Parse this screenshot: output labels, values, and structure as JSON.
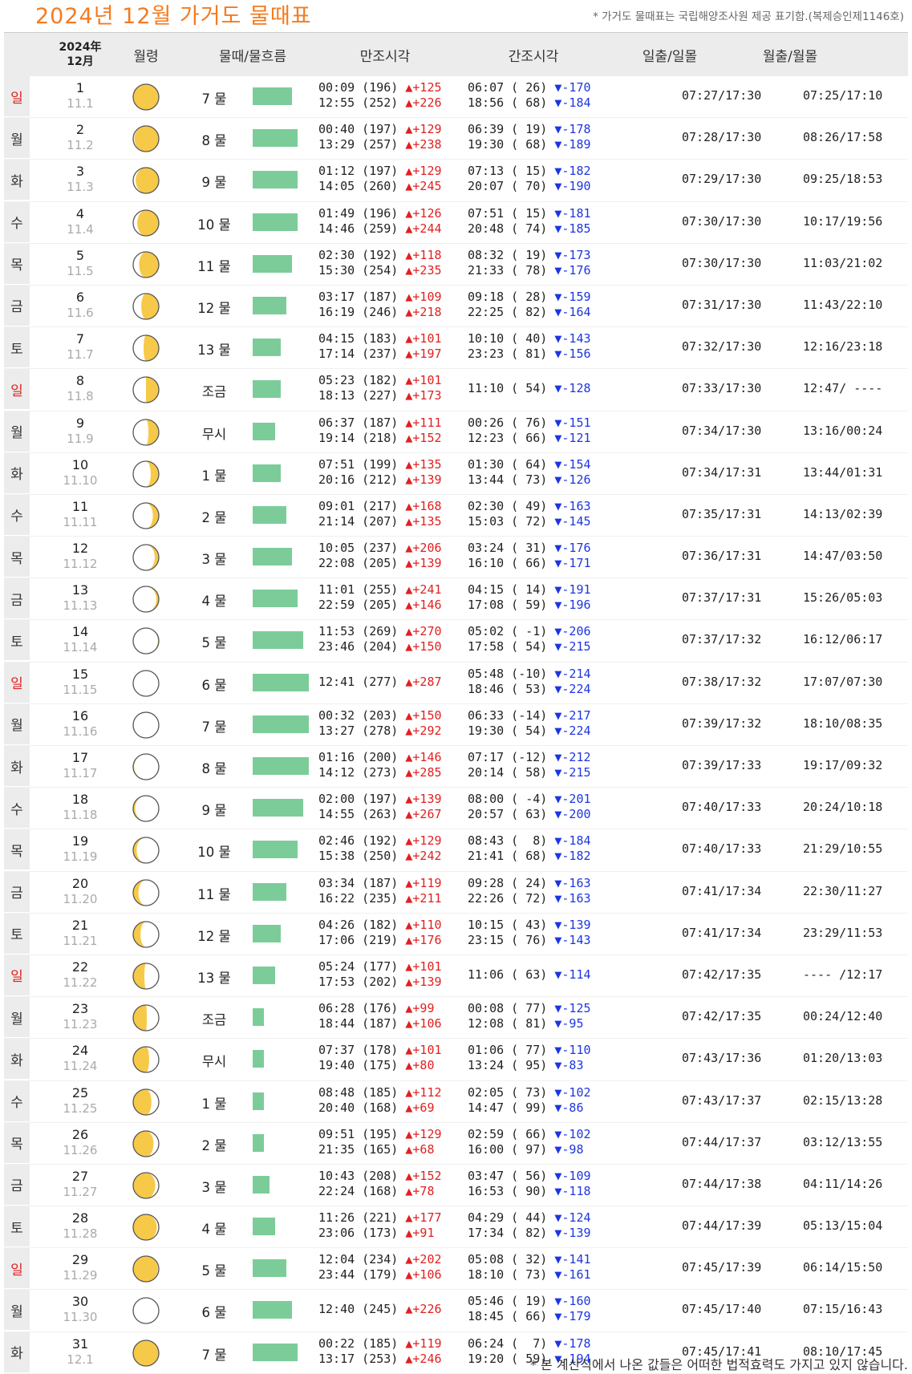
{
  "title": "2024년 12월 가거도 물때표",
  "notice": "* 가거도 물때표는 국립해양조사원 제공 표기함.(복제승인제1146호)",
  "footer": "* 본 계산식에서 나온 값들은 어떠한 법적효력도 가지고 있지 않습니다.",
  "headers": {
    "year": "2024年",
    "month": "12月",
    "moon_age": "월령",
    "tide": "물때/물흐름",
    "high": "만조시각",
    "low": "간조시각",
    "sun": "일출/일몰",
    "moon": "월출/월몰"
  },
  "colors": {
    "title": "#f47b20",
    "sunday": "#e02020",
    "rise": "#e02020",
    "fall": "#1d35e0",
    "flow_bar": "#7ccc9a",
    "moon_fill": "#f7c948"
  },
  "rows": [
    {
      "dow": "일",
      "sun": true,
      "day": "1",
      "lunar": "11.1",
      "mul": "7 물",
      "flow": 0.7,
      "phase": 0.04,
      "high": [
        "00:09 (196)",
        "12:55 (252)"
      ],
      "hc": [
        "+125",
        "+226"
      ],
      "low": [
        "06:07 ( 26)",
        "18:56 ( 68)"
      ],
      "lc": [
        "-170",
        "-184"
      ],
      "sr": "07:27/17:30",
      "mr": "07:25/17:10"
    },
    {
      "dow": "월",
      "sun": false,
      "day": "2",
      "lunar": "11.2",
      "mul": "8 물",
      "flow": 0.8,
      "phase": 0.07,
      "high": [
        "00:40 (197)",
        "13:29 (257)"
      ],
      "hc": [
        "+129",
        "+238"
      ],
      "low": [
        "06:39 ( 19)",
        "19:30 ( 68)"
      ],
      "lc": [
        "-178",
        "-189"
      ],
      "sr": "07:28/17:30",
      "mr": "08:26/17:58"
    },
    {
      "dow": "화",
      "sun": false,
      "day": "3",
      "lunar": "11.3",
      "mul": "9 물",
      "flow": 0.8,
      "phase": 0.1,
      "high": [
        "01:12 (197)",
        "14:05 (260)"
      ],
      "hc": [
        "+129",
        "+245"
      ],
      "low": [
        "07:13 ( 15)",
        "20:07 ( 70)"
      ],
      "lc": [
        "-182",
        "-190"
      ],
      "sr": "07:29/17:30",
      "mr": "09:25/18:53"
    },
    {
      "dow": "수",
      "sun": false,
      "day": "4",
      "lunar": "11.4",
      "mul": "10 물",
      "flow": 0.8,
      "phase": 0.13,
      "high": [
        "01:49 (196)",
        "14:46 (259)"
      ],
      "hc": [
        "+126",
        "+244"
      ],
      "low": [
        "07:51 ( 15)",
        "20:48 ( 74)"
      ],
      "lc": [
        "-181",
        "-185"
      ],
      "sr": "07:30/17:30",
      "mr": "10:17/19:56"
    },
    {
      "dow": "목",
      "sun": false,
      "day": "5",
      "lunar": "11.5",
      "mul": "11 물",
      "flow": 0.7,
      "phase": 0.16,
      "high": [
        "02:30 (192)",
        "15:30 (254)"
      ],
      "hc": [
        "+118",
        "+235"
      ],
      "low": [
        "08:32 ( 19)",
        "21:33 ( 78)"
      ],
      "lc": [
        "-173",
        "-176"
      ],
      "sr": "07:30/17:30",
      "mr": "11:03/21:02"
    },
    {
      "dow": "금",
      "sun": false,
      "day": "6",
      "lunar": "11.6",
      "mul": "12 물",
      "flow": 0.6,
      "phase": 0.19,
      "high": [
        "03:17 (187)",
        "16:19 (246)"
      ],
      "hc": [
        "+109",
        "+218"
      ],
      "low": [
        "09:18 ( 28)",
        "22:25 ( 82)"
      ],
      "lc": [
        "-159",
        "-164"
      ],
      "sr": "07:31/17:30",
      "mr": "11:43/22:10"
    },
    {
      "dow": "토",
      "sun": false,
      "day": "7",
      "lunar": "11.7",
      "mul": "13 물",
      "flow": 0.5,
      "phase": 0.22,
      "high": [
        "04:15 (183)",
        "17:14 (237)"
      ],
      "hc": [
        "+101",
        "+197"
      ],
      "low": [
        "10:10 ( 40)",
        "23:23 ( 81)"
      ],
      "lc": [
        "-143",
        "-156"
      ],
      "sr": "07:32/17:30",
      "mr": "12:16/23:18"
    },
    {
      "dow": "일",
      "sun": true,
      "day": "8",
      "lunar": "11.8",
      "mul": "조금",
      "flow": 0.5,
      "phase": 0.25,
      "high": [
        "05:23 (182)",
        "18:13 (227)"
      ],
      "hc": [
        "+101",
        "+173"
      ],
      "low": [
        "11:10 ( 54)"
      ],
      "lc": [
        "-128"
      ],
      "sr": "07:33/17:30",
      "mr": "12:47/ ----"
    },
    {
      "dow": "월",
      "sun": false,
      "day": "9",
      "lunar": "11.9",
      "mul": "무시",
      "flow": 0.4,
      "phase": 0.28,
      "high": [
        "06:37 (187)",
        "19:14 (218)"
      ],
      "hc": [
        "+111",
        "+152"
      ],
      "low": [
        "00:26 ( 76)",
        "12:23 ( 66)"
      ],
      "lc": [
        "-151",
        "-121"
      ],
      "sr": "07:34/17:30",
      "mr": "13:16/00:24"
    },
    {
      "dow": "화",
      "sun": false,
      "day": "10",
      "lunar": "11.10",
      "mul": "1 물",
      "flow": 0.5,
      "phase": 0.31,
      "high": [
        "07:51 (199)",
        "20:16 (212)"
      ],
      "hc": [
        "+135",
        "+139"
      ],
      "low": [
        "01:30 ( 64)",
        "13:44 ( 73)"
      ],
      "lc": [
        "-154",
        "-126"
      ],
      "sr": "07:34/17:31",
      "mr": "13:44/01:31"
    },
    {
      "dow": "수",
      "sun": false,
      "day": "11",
      "lunar": "11.11",
      "mul": "2 물",
      "flow": 0.6,
      "phase": 0.34,
      "high": [
        "09:01 (217)",
        "21:14 (207)"
      ],
      "hc": [
        "+168",
        "+135"
      ],
      "low": [
        "02:30 ( 49)",
        "15:03 ( 72)"
      ],
      "lc": [
        "-163",
        "-145"
      ],
      "sr": "07:35/17:31",
      "mr": "14:13/02:39"
    },
    {
      "dow": "목",
      "sun": false,
      "day": "12",
      "lunar": "11.12",
      "mul": "3 물",
      "flow": 0.7,
      "phase": 0.37,
      "high": [
        "10:05 (237)",
        "22:08 (205)"
      ],
      "hc": [
        "+206",
        "+139"
      ],
      "low": [
        "03:24 ( 31)",
        "16:10 ( 66)"
      ],
      "lc": [
        "-176",
        "-171"
      ],
      "sr": "07:36/17:31",
      "mr": "14:47/03:50"
    },
    {
      "dow": "금",
      "sun": false,
      "day": "13",
      "lunar": "11.13",
      "mul": "4 물",
      "flow": 0.8,
      "phase": 0.4,
      "high": [
        "11:01 (255)",
        "22:59 (205)"
      ],
      "hc": [
        "+241",
        "+146"
      ],
      "low": [
        "04:15 ( 14)",
        "17:08 ( 59)"
      ],
      "lc": [
        "-191",
        "-196"
      ],
      "sr": "07:37/17:31",
      "mr": "15:26/05:03"
    },
    {
      "dow": "토",
      "sun": false,
      "day": "14",
      "lunar": "11.14",
      "mul": "5 물",
      "flow": 0.9,
      "phase": 0.44,
      "high": [
        "11:53 (269)",
        "23:46 (204)"
      ],
      "hc": [
        "+270",
        "+150"
      ],
      "low": [
        "05:02 ( -1)",
        "17:58 ( 54)"
      ],
      "lc": [
        "-206",
        "-215"
      ],
      "sr": "07:37/17:32",
      "mr": "16:12/06:17"
    },
    {
      "dow": "일",
      "sun": true,
      "day": "15",
      "lunar": "11.15",
      "mul": "6 물",
      "flow": 1.0,
      "phase": 0.5,
      "high": [
        "12:41 (277)"
      ],
      "hc": [
        "+287"
      ],
      "low": [
        "05:48 (-10)",
        "18:46 ( 53)"
      ],
      "lc": [
        "-214",
        "-224"
      ],
      "sr": "07:38/17:32",
      "mr": "17:07/07:30"
    },
    {
      "dow": "월",
      "sun": false,
      "day": "16",
      "lunar": "11.16",
      "mul": "7 물",
      "flow": 1.0,
      "phase": 0.53,
      "high": [
        "00:32 (203)",
        "13:27 (278)"
      ],
      "hc": [
        "+150",
        "+292"
      ],
      "low": [
        "06:33 (-14)",
        "19:30 ( 54)"
      ],
      "lc": [
        "-217",
        "-224"
      ],
      "sr": "07:39/17:32",
      "mr": "18:10/08:35"
    },
    {
      "dow": "화",
      "sun": false,
      "day": "17",
      "lunar": "11.17",
      "mul": "8 물",
      "flow": 1.0,
      "phase": 0.56,
      "high": [
        "01:16 (200)",
        "14:12 (273)"
      ],
      "hc": [
        "+146",
        "+285"
      ],
      "low": [
        "07:17 (-12)",
        "20:14 ( 58)"
      ],
      "lc": [
        "-212",
        "-215"
      ],
      "sr": "07:39/17:33",
      "mr": "19:17/09:32"
    },
    {
      "dow": "수",
      "sun": false,
      "day": "18",
      "lunar": "11.18",
      "mul": "9 물",
      "flow": 0.9,
      "phase": 0.59,
      "high": [
        "02:00 (197)",
        "14:55 (263)"
      ],
      "hc": [
        "+139",
        "+267"
      ],
      "low": [
        "08:00 ( -4)",
        "20:57 ( 63)"
      ],
      "lc": [
        "-201",
        "-200"
      ],
      "sr": "07:40/17:33",
      "mr": "20:24/10:18"
    },
    {
      "dow": "목",
      "sun": false,
      "day": "19",
      "lunar": "11.19",
      "mul": "10 물",
      "flow": 0.8,
      "phase": 0.62,
      "high": [
        "02:46 (192)",
        "15:38 (250)"
      ],
      "hc": [
        "+129",
        "+242"
      ],
      "low": [
        "08:43 (  8)",
        "21:41 ( 68)"
      ],
      "lc": [
        "-184",
        "-182"
      ],
      "sr": "07:40/17:33",
      "mr": "21:29/10:55"
    },
    {
      "dow": "금",
      "sun": false,
      "day": "20",
      "lunar": "11.20",
      "mul": "11 물",
      "flow": 0.6,
      "phase": 0.65,
      "high": [
        "03:34 (187)",
        "16:22 (235)"
      ],
      "hc": [
        "+119",
        "+211"
      ],
      "low": [
        "09:28 ( 24)",
        "22:26 ( 72)"
      ],
      "lc": [
        "-163",
        "-163"
      ],
      "sr": "07:41/17:34",
      "mr": "22:30/11:27"
    },
    {
      "dow": "토",
      "sun": false,
      "day": "21",
      "lunar": "11.21",
      "mul": "12 물",
      "flow": 0.5,
      "phase": 0.68,
      "high": [
        "04:26 (182)",
        "17:06 (219)"
      ],
      "hc": [
        "+110",
        "+176"
      ],
      "low": [
        "10:15 ( 43)",
        "23:15 ( 76)"
      ],
      "lc": [
        "-139",
        "-143"
      ],
      "sr": "07:41/17:34",
      "mr": "23:29/11:53"
    },
    {
      "dow": "일",
      "sun": true,
      "day": "22",
      "lunar": "11.22",
      "mul": "13 물",
      "flow": 0.4,
      "phase": 0.73,
      "high": [
        "05:24 (177)",
        "17:53 (202)"
      ],
      "hc": [
        "+101",
        "+139"
      ],
      "low": [
        "11:06 ( 63)"
      ],
      "lc": [
        "-114"
      ],
      "sr": "07:42/17:35",
      "mr": "---- /12:17"
    },
    {
      "dow": "월",
      "sun": false,
      "day": "23",
      "lunar": "11.23",
      "mul": "조금",
      "flow": 0.2,
      "phase": 0.76,
      "high": [
        "06:28 (176)",
        "18:44 (187)"
      ],
      "hc": [
        "+99",
        "+106"
      ],
      "low": [
        "00:08 ( 77)",
        "12:08 ( 81)"
      ],
      "lc": [
        "-125",
        "-95"
      ],
      "sr": "07:42/17:35",
      "mr": "00:24/12:40"
    },
    {
      "dow": "화",
      "sun": false,
      "day": "24",
      "lunar": "11.24",
      "mul": "무시",
      "flow": 0.2,
      "phase": 0.79,
      "high": [
        "07:37 (178)",
        "19:40 (175)"
      ],
      "hc": [
        "+101",
        "+80"
      ],
      "low": [
        "01:06 ( 77)",
        "13:24 ( 95)"
      ],
      "lc": [
        "-110",
        "-83"
      ],
      "sr": "07:43/17:36",
      "mr": "01:20/13:03"
    },
    {
      "dow": "수",
      "sun": false,
      "day": "25",
      "lunar": "11.25",
      "mul": "1 물",
      "flow": 0.2,
      "phase": 0.82,
      "high": [
        "08:48 (185)",
        "20:40 (168)"
      ],
      "hc": [
        "+112",
        "+69"
      ],
      "low": [
        "02:05 ( 73)",
        "14:47 ( 99)"
      ],
      "lc": [
        "-102",
        "-86"
      ],
      "sr": "07:43/17:37",
      "mr": "02:15/13:28"
    },
    {
      "dow": "목",
      "sun": false,
      "day": "26",
      "lunar": "11.26",
      "mul": "2 물",
      "flow": 0.2,
      "phase": 0.85,
      "high": [
        "09:51 (195)",
        "21:35 (165)"
      ],
      "hc": [
        "+129",
        "+68"
      ],
      "low": [
        "02:59 ( 66)",
        "16:00 ( 97)"
      ],
      "lc": [
        "-102",
        "-98"
      ],
      "sr": "07:44/17:37",
      "mr": "03:12/13:55"
    },
    {
      "dow": "금",
      "sun": false,
      "day": "27",
      "lunar": "11.27",
      "mul": "3 물",
      "flow": 0.3,
      "phase": 0.88,
      "high": [
        "10:43 (208)",
        "22:24 (168)"
      ],
      "hc": [
        "+152",
        "+78"
      ],
      "low": [
        "03:47 ( 56)",
        "16:53 ( 90)"
      ],
      "lc": [
        "-109",
        "-118"
      ],
      "sr": "07:44/17:38",
      "mr": "04:11/14:26"
    },
    {
      "dow": "토",
      "sun": false,
      "day": "28",
      "lunar": "11.28",
      "mul": "4 물",
      "flow": 0.4,
      "phase": 0.91,
      "high": [
        "11:26 (221)",
        "23:06 (173)"
      ],
      "hc": [
        "+177",
        "+91"
      ],
      "low": [
        "04:29 ( 44)",
        "17:34 ( 82)"
      ],
      "lc": [
        "-124",
        "-139"
      ],
      "sr": "07:44/17:39",
      "mr": "05:13/15:04"
    },
    {
      "dow": "일",
      "sun": true,
      "day": "29",
      "lunar": "11.29",
      "mul": "5 물",
      "flow": 0.6,
      "phase": 0.94,
      "high": [
        "12:04 (234)",
        "23:44 (179)"
      ],
      "hc": [
        "+202",
        "+106"
      ],
      "low": [
        "05:08 ( 32)",
        "18:10 ( 73)"
      ],
      "lc": [
        "-141",
        "-161"
      ],
      "sr": "07:45/17:39",
      "mr": "06:14/15:50"
    },
    {
      "dow": "월",
      "sun": false,
      "day": "30",
      "lunar": "11.30",
      "mul": "6 물",
      "flow": 0.7,
      "phase": 0.0,
      "high": [
        "12:40 (245)"
      ],
      "hc": [
        "+226"
      ],
      "low": [
        "05:46 ( 19)",
        "18:45 ( 66)"
      ],
      "lc": [
        "-160",
        "-179"
      ],
      "sr": "07:45/17:40",
      "mr": "07:15/16:43"
    },
    {
      "dow": "화",
      "sun": false,
      "day": "31",
      "lunar": "12.1",
      "mul": "7 물",
      "flow": 0.8,
      "phase": 0.03,
      "high": [
        "00:22 (185)",
        "13:17 (253)"
      ],
      "hc": [
        "+119",
        "+246"
      ],
      "low": [
        "06:24 (  7)",
        "19:20 ( 59)"
      ],
      "lc": [
        "-178",
        "-194"
      ],
      "sr": "07:45/17:41",
      "mr": "08:10/17:45"
    }
  ]
}
